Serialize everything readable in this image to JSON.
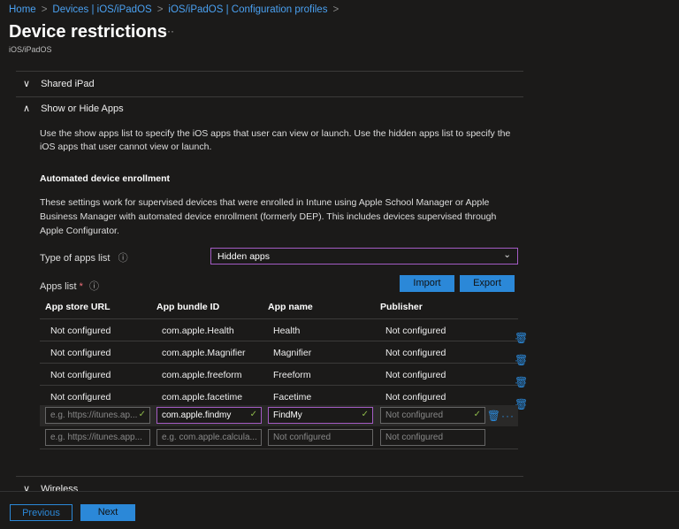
{
  "breadcrumb": [
    "Home",
    "Devices | iOS/iPadOS",
    "iOS/iPadOS | Configuration profiles"
  ],
  "title": "Device restrictions",
  "more": "···",
  "subtitle": "iOS/iPadOS",
  "sections": {
    "shared": "Shared iPad",
    "show_hide": "Show or Hide Apps",
    "wireless": "Wireless"
  },
  "description": "Use the show apps list to specify the iOS apps that user can view or launch. Use the hidden apps list to specify the iOS apps that user cannot view or launch.",
  "ade_heading": "Automated device enrollment",
  "ade_text": "These settings work for supervised devices that were enrolled in Intune using Apple School Manager or Apple Business Manager with automated device enrollment (formerly DEP). This includes devices supervised through Apple Configurator.",
  "type_label": "Type of apps list",
  "type_value": "Hidden apps",
  "apps_list_label": "Apps list",
  "required": "*",
  "import": "Import",
  "export": "Export",
  "columns": [
    "App store URL",
    "App bundle ID",
    "App name",
    "Publisher"
  ],
  "rows": [
    [
      "Not configured",
      "com.apple.Health",
      "Health",
      "Not configured"
    ],
    [
      "Not configured",
      "com.apple.Magnifier",
      "Magnifier",
      "Not configured"
    ],
    [
      "Not configured",
      "com.apple.freeform",
      "Freeform",
      "Not configured"
    ],
    [
      "Not configured",
      "com.apple.facetime",
      "Facetime",
      "Not configured"
    ]
  ],
  "edit_row": [
    "e.g. https://itunes.ap...",
    "com.apple.findmy",
    "FindMy",
    "Not configured"
  ],
  "new_row": [
    "e.g. https://itunes.app...",
    "e.g. com.apple.calcula...",
    "Not configured",
    "Not configured"
  ],
  "footer": {
    "previous": "Previous",
    "next": "Next"
  }
}
